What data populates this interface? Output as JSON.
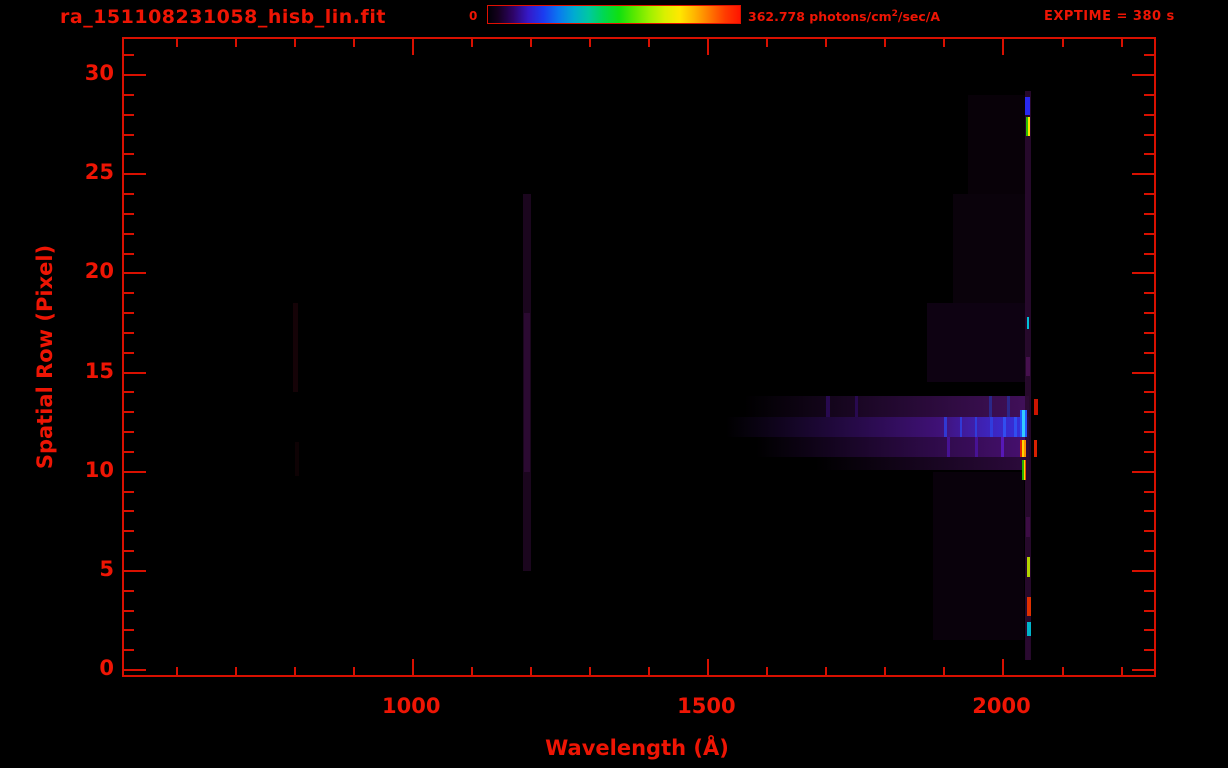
{
  "header": {
    "title": "ra_151108231058_hisb_lin.fit",
    "colorbar": {
      "min_label": "0",
      "max_value": "362.778",
      "units_before_sup": " photons/cm",
      "units_sup": "2",
      "units_after_sup": "/sec/A"
    },
    "exptime_label": "EXPTIME = 380 s"
  },
  "colors": {
    "accent_red": "#ee1504",
    "axis_red": "#d81000",
    "background": "#000000"
  },
  "chart_data": {
    "type": "heatmap",
    "title": "ra_151108231058_hisb_lin.fit",
    "xlabel": "Wavelength (Å)",
    "ylabel": "Spatial Row (Pixel)",
    "xlim": [
      510,
      2255
    ],
    "ylim": [
      -0.25,
      31.8
    ],
    "x_major_ticks": [
      1000,
      1500,
      2000
    ],
    "x_minor_step": 100,
    "y_major_ticks": [
      0,
      5,
      10,
      15,
      20,
      25,
      30
    ],
    "y_minor_step": 1,
    "grid": false,
    "legend_position": "none",
    "colorbar": {
      "min": 0,
      "max": 362.778,
      "units": "photons/cm^2/sec/A",
      "palette": "rainbow-linear"
    },
    "exptime_seconds": 380,
    "features": [
      {
        "name": "faint-line-800",
        "x0": 797,
        "x1": 805,
        "row0": 14.0,
        "row1": 18.5,
        "color": "#170308",
        "opacity": 0.9
      },
      {
        "name": "faint-line-800-lower",
        "x0": 799,
        "x1": 806,
        "row0": 9.8,
        "row1": 11.5,
        "color": "#120305",
        "opacity": 0.8
      },
      {
        "name": "lyman-alpha-airglow",
        "x0": 1186,
        "x1": 1200,
        "row0": 5.0,
        "row1": 24.0,
        "color": "#1c0620",
        "opacity": 0.95
      },
      {
        "name": "lyman-alpha-core",
        "x0": 1188,
        "x1": 1198,
        "row0": 10.0,
        "row1": 18.0,
        "color": "#2b0a31",
        "opacity": 1
      },
      {
        "name": "continuum-row13",
        "x0": 1560,
        "x1": 2043,
        "row0": 12.75,
        "row1": 13.8,
        "color": "#41105a",
        "opacity": 1,
        "gradient": true
      },
      {
        "name": "continuum-row12",
        "x0": 1530,
        "x1": 2043,
        "row0": 11.75,
        "row1": 12.75,
        "color": "#5a18a8",
        "opacity": 1,
        "gradient": true
      },
      {
        "name": "continuum-row12-blue",
        "x0": 1890,
        "x1": 2043,
        "row0": 11.75,
        "row1": 12.75,
        "color": "#2a35e8",
        "opacity": 0.85,
        "gradient": true
      },
      {
        "name": "continuum-row11",
        "x0": 1580,
        "x1": 2043,
        "row0": 10.75,
        "row1": 11.75,
        "color": "#471070",
        "opacity": 1,
        "gradient": true
      },
      {
        "name": "continuum-row10",
        "x0": 1680,
        "x1": 2043,
        "row0": 10.1,
        "row1": 10.75,
        "color": "#2c0a3c",
        "opacity": 1,
        "gradient": true
      },
      {
        "name": "band-stripe",
        "x0": 1700,
        "x1": 1706,
        "row0": 12.75,
        "row1": 13.8,
        "color": "#2a0a55",
        "opacity": 0.9
      },
      {
        "name": "band-stripe",
        "x0": 1748,
        "x1": 1753,
        "row0": 12.75,
        "row1": 13.8,
        "color": "#2a0a55",
        "opacity": 0.9
      },
      {
        "name": "band-stripe",
        "x0": 1975,
        "x1": 1981,
        "row0": 12.75,
        "row1": 13.8,
        "color": "#2a2a90",
        "opacity": 0.9
      },
      {
        "name": "band-stripe",
        "x0": 2006,
        "x1": 2011,
        "row0": 12.75,
        "row1": 13.8,
        "color": "#2a2a90",
        "opacity": 0.9
      },
      {
        "name": "band-stripe",
        "x0": 1900,
        "x1": 1905,
        "row0": 11.75,
        "row1": 12.75,
        "color": "#2f3fe0",
        "opacity": 0.85
      },
      {
        "name": "band-stripe",
        "x0": 1926,
        "x1": 1930,
        "row0": 11.75,
        "row1": 12.75,
        "color": "#2f3fe0",
        "opacity": 0.85
      },
      {
        "name": "band-stripe",
        "x0": 1951,
        "x1": 1956,
        "row0": 11.75,
        "row1": 12.75,
        "color": "#2f3fe0",
        "opacity": 0.9
      },
      {
        "name": "band-stripe",
        "x0": 1977,
        "x1": 1982,
        "row0": 11.75,
        "row1": 12.75,
        "color": "#2f3fe0",
        "opacity": 0.9
      },
      {
        "name": "band-stripe",
        "x0": 2000,
        "x1": 2005,
        "row0": 11.75,
        "row1": 12.75,
        "color": "#3050f0",
        "opacity": 0.95
      },
      {
        "name": "band-stripe",
        "x0": 2018,
        "x1": 2023,
        "row0": 11.75,
        "row1": 12.75,
        "color": "#3050f0",
        "opacity": 0.95
      },
      {
        "name": "band-stripe",
        "x0": 1905,
        "x1": 1910,
        "row0": 10.75,
        "row1": 11.75,
        "color": "#4a14a0",
        "opacity": 0.85
      },
      {
        "name": "band-stripe",
        "x0": 1952,
        "x1": 1957,
        "row0": 10.75,
        "row1": 11.75,
        "color": "#4a14a0",
        "opacity": 0.85
      },
      {
        "name": "band-stripe",
        "x0": 1996,
        "x1": 2001,
        "row0": 10.75,
        "row1": 11.75,
        "color": "#5a1ac0",
        "opacity": 0.9
      },
      {
        "name": "faint-region-upper",
        "x0": 1870,
        "x1": 2040,
        "row0": 14.5,
        "row1": 18.5,
        "color": "#120316",
        "opacity": 0.8
      },
      {
        "name": "faint-region-upper2",
        "x0": 1915,
        "x1": 2040,
        "row0": 18.5,
        "row1": 24.0,
        "color": "#0d020e",
        "opacity": 0.8
      },
      {
        "name": "faint-region-top",
        "x0": 1940,
        "x1": 2040,
        "row0": 24.0,
        "row1": 29.0,
        "color": "#0b020c",
        "opacity": 0.7
      },
      {
        "name": "faint-region-lower",
        "x0": 1880,
        "x1": 2035,
        "row0": 1.5,
        "row1": 10.0,
        "color": "#0d0210",
        "opacity": 0.7
      },
      {
        "name": "emission-column",
        "x0": 2037,
        "x1": 2047,
        "row0": 0.5,
        "row1": 29.2,
        "color": "#2a0a30",
        "opacity": 0.9
      },
      {
        "name": "column-blue-row29",
        "x0": 2037,
        "x1": 2045,
        "row0": 28.0,
        "row1": 28.9,
        "color": "#2828f0",
        "opacity": 1
      },
      {
        "name": "column-green-row27",
        "x0": 2038,
        "x1": 2041,
        "row0": 26.9,
        "row1": 27.9,
        "color": "#30c000",
        "opacity": 1
      },
      {
        "name": "column-yellow-row27",
        "x0": 2041,
        "x1": 2045,
        "row0": 26.9,
        "row1": 27.9,
        "color": "#ffe400",
        "opacity": 1
      },
      {
        "name": "column-cyan-row17",
        "x0": 2039,
        "x1": 2044,
        "row0": 17.2,
        "row1": 17.8,
        "color": "#00c0d8",
        "opacity": 1
      },
      {
        "name": "column-purple-row15",
        "x0": 2038,
        "x1": 2045,
        "row0": 14.8,
        "row1": 15.8,
        "color": "#46104e",
        "opacity": 1
      },
      {
        "name": "terminal-blue-row12",
        "x0": 2028,
        "x1": 2040,
        "row0": 11.75,
        "row1": 13.1,
        "color": "#2255ff",
        "opacity": 1
      },
      {
        "name": "terminal-cyan-row12",
        "x0": 2032,
        "x1": 2036,
        "row0": 11.75,
        "row1": 13.1,
        "color": "#33ccff",
        "opacity": 1
      },
      {
        "name": "red-line-row13",
        "x0": 2052,
        "x1": 2058,
        "row0": 12.85,
        "row1": 13.65,
        "color": "#cc1400",
        "opacity": 1
      },
      {
        "name": "cluster-red-row11",
        "x0": 2028,
        "x1": 2031,
        "row0": 10.75,
        "row1": 11.6,
        "color": "#e02400",
        "opacity": 1
      },
      {
        "name": "cluster-yellow-row11",
        "x0": 2031,
        "x1": 2035,
        "row0": 10.75,
        "row1": 11.6,
        "color": "#ffd800",
        "opacity": 1
      },
      {
        "name": "cluster-orange-row11",
        "x0": 2035,
        "x1": 2038,
        "row0": 10.75,
        "row1": 11.6,
        "color": "#ff8c00",
        "opacity": 1
      },
      {
        "name": "cluster-red2-row11",
        "x0": 2052,
        "x1": 2056,
        "row0": 10.75,
        "row1": 11.6,
        "color": "#d82000",
        "opacity": 1
      },
      {
        "name": "rainbow-green-row10",
        "x0": 2031,
        "x1": 2034,
        "row0": 9.6,
        "row1": 10.6,
        "color": "#28b400",
        "opacity": 1
      },
      {
        "name": "rainbow-yellow-row10",
        "x0": 2034,
        "x1": 2037,
        "row0": 9.6,
        "row1": 10.6,
        "color": "#ffd400",
        "opacity": 1
      },
      {
        "name": "rainbow-orange-row10",
        "x0": 2037,
        "x1": 2039,
        "row0": 9.6,
        "row1": 10.6,
        "color": "#e05000",
        "opacity": 1
      },
      {
        "name": "column-purple-row7",
        "x0": 2038,
        "x1": 2045,
        "row0": 6.7,
        "row1": 7.7,
        "color": "#3c0c44",
        "opacity": 1
      },
      {
        "name": "column-yellowgreen-row5",
        "x0": 2039,
        "x1": 2045,
        "row0": 4.7,
        "row1": 5.7,
        "color": "#b4d400",
        "opacity": 1
      },
      {
        "name": "column-red-row3",
        "x0": 2040,
        "x1": 2046,
        "row0": 2.7,
        "row1": 3.7,
        "color": "#e03000",
        "opacity": 1
      },
      {
        "name": "column-cyan-row2",
        "x0": 2040,
        "x1": 2046,
        "row0": 1.7,
        "row1": 2.4,
        "color": "#00b4cc",
        "opacity": 1
      },
      {
        "name": "column-purple-row1",
        "x0": 2038,
        "x1": 2045,
        "row0": 0.5,
        "row1": 1.6,
        "color": "#2a0930",
        "opacity": 0.95
      }
    ]
  }
}
